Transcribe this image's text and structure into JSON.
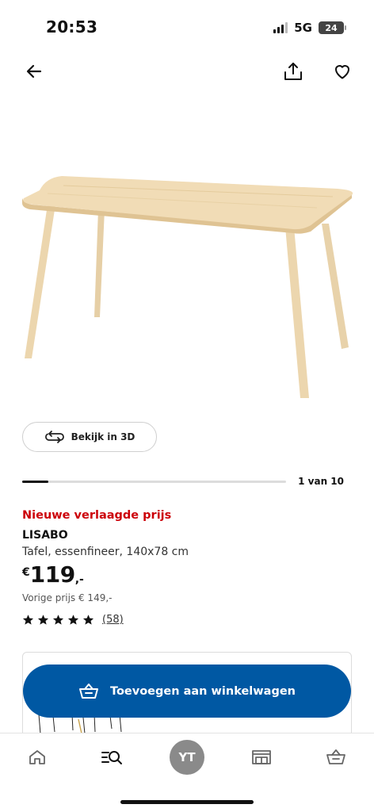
{
  "status_bar": {
    "time": "20:53",
    "network": "5G",
    "battery": "24"
  },
  "top_nav": {
    "back_icon": "arrow-left-icon",
    "share_icon": "share-icon",
    "favorite_icon": "heart-icon"
  },
  "gallery": {
    "view_3d_label": "Bekijk in 3D",
    "counter": "1 van 10",
    "progress": 0.1
  },
  "product": {
    "promo_label": "Nieuwe verlaagde prijs",
    "name": "LISABO",
    "description": "Tafel, essenfineer, 140x78 cm",
    "price": {
      "currency": "€",
      "integer": "119",
      "decimal": ",-"
    },
    "previous_price": "Vorige prijs € 149,-",
    "rating": {
      "stars": 5,
      "max": 5,
      "count": "(58)"
    }
  },
  "cart_button": {
    "label": "Toevoegen aan winkelwagen",
    "icon": "basket-icon"
  },
  "tab_bar": {
    "items": [
      {
        "name": "home",
        "icon": "home-icon"
      },
      {
        "name": "search",
        "icon": "search-list-icon"
      },
      {
        "name": "profile",
        "initials": "YT"
      },
      {
        "name": "store",
        "icon": "store-icon"
      },
      {
        "name": "cart",
        "icon": "basket-icon"
      }
    ]
  },
  "colors": {
    "promo": "#cc0008",
    "primary": "#0058a3",
    "avatar": "#8a8a8a",
    "wood": "#efd9b4"
  }
}
